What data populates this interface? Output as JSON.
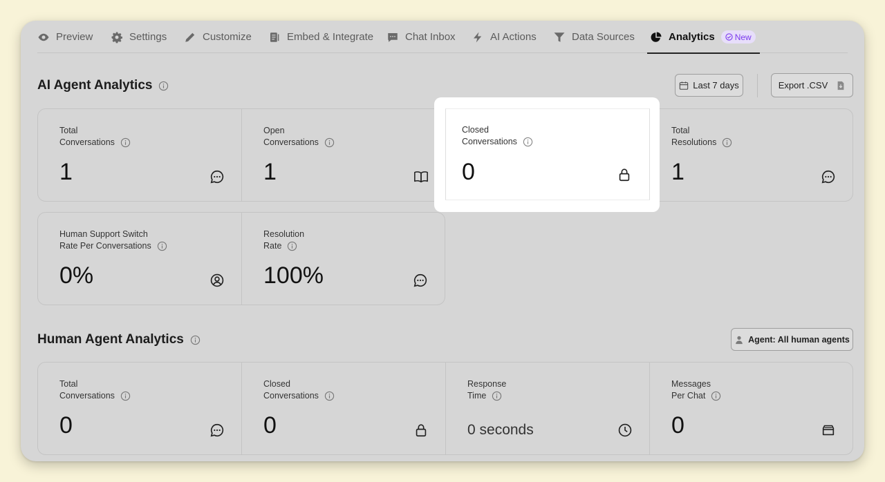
{
  "tabs": [
    {
      "label": "Preview",
      "icon": "eye-icon"
    },
    {
      "label": "Settings",
      "icon": "gear-icon"
    },
    {
      "label": "Customize",
      "icon": "pencil-icon"
    },
    {
      "label": "Embed & Integrate",
      "icon": "embed-icon"
    },
    {
      "label": "Chat Inbox",
      "icon": "chat-icon"
    },
    {
      "label": "AI Actions",
      "icon": "bolt-icon"
    },
    {
      "label": "Data Sources",
      "icon": "funnel-icon"
    },
    {
      "label": "Analytics",
      "icon": "pie-chart-icon",
      "active": true,
      "badge": "New"
    }
  ],
  "ai_section": {
    "title": "AI Agent Analytics",
    "date_range": "Last 7 days",
    "export_label": "Export .CSV",
    "cards": [
      {
        "line1": "Total",
        "line2": "Conversations",
        "value": "1",
        "icon": "chat-bubble-icon"
      },
      {
        "line1": "Open",
        "line2": "Conversations",
        "value": "1",
        "icon": "book-open-icon"
      },
      {
        "line1": "Closed",
        "line2": "Conversations",
        "value": "0",
        "icon": "lock-icon"
      },
      {
        "line1": "Total",
        "line2": "Resolutions",
        "value": "1",
        "icon": "chat-bubble-icon"
      },
      {
        "line1": "Human Support Switch",
        "line2": "Rate Per Conversations",
        "value": "0%",
        "icon": "user-circle-icon"
      },
      {
        "line1": "Resolution",
        "line2": "Rate",
        "value": "100%",
        "icon": "chat-bubble-icon"
      }
    ]
  },
  "human_section": {
    "title": "Human Agent Analytics",
    "agent_filter": "Agent: All human agents",
    "cards": [
      {
        "line1": "Total",
        "line2": "Conversations",
        "value": "0",
        "icon": "chat-bubble-icon"
      },
      {
        "line1": "Closed",
        "line2": "Conversations",
        "value": "0",
        "icon": "lock-icon"
      },
      {
        "line1": "Response",
        "line2": "Time",
        "value": "0 seconds",
        "icon": "clock-icon"
      },
      {
        "line1": "Messages",
        "line2": "Per Chat",
        "value": "0",
        "icon": "inbox-tray-icon"
      }
    ]
  },
  "colors": {
    "page_bg": "#f8f3d8",
    "window_bg": "#d6d6d6",
    "badge_bg": "#e7defa",
    "badge_fg": "#7c3aed",
    "highlight": "#ffffff"
  }
}
